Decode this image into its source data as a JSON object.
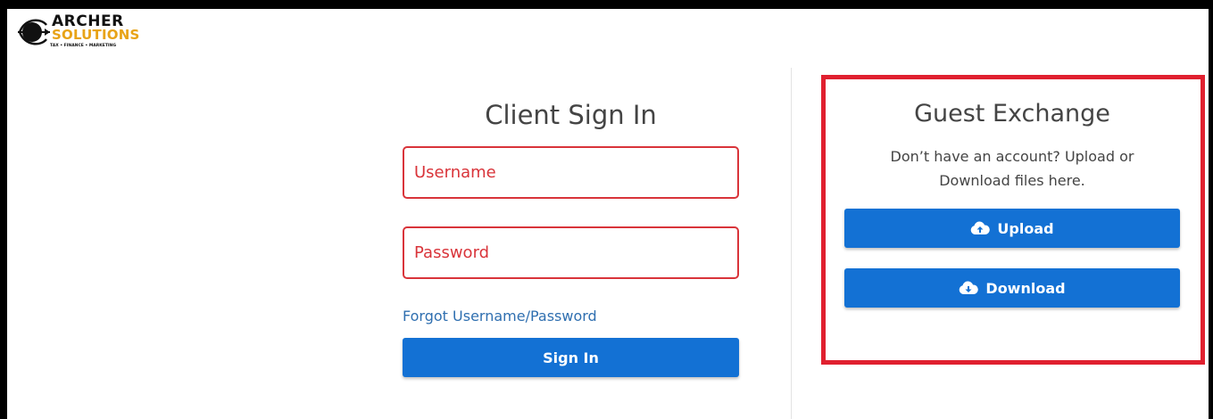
{
  "logo": {
    "line1": "ARCHER",
    "line2": "SOLUTIONS",
    "tagline": "TAX • FINANCE • MARKETING",
    "colors": {
      "dark": "#111111",
      "gold": "#e8a317"
    }
  },
  "signin": {
    "title": "Client Sign In",
    "username_placeholder": "Username",
    "password_placeholder": "Password",
    "forgot_label": "Forgot Username/Password",
    "button_label": "Sign In"
  },
  "guest": {
    "title": "Guest Exchange",
    "description": "Don’t have an account? Upload or Download files here.",
    "upload": {
      "label": "Upload",
      "icon": "cloud-upload-icon"
    },
    "download": {
      "label": "Download",
      "icon": "cloud-download-icon"
    }
  },
  "colors": {
    "accent": "#1371d4",
    "error": "#d9343a",
    "highlight": "#e0202f",
    "link": "#2f6fb0"
  }
}
